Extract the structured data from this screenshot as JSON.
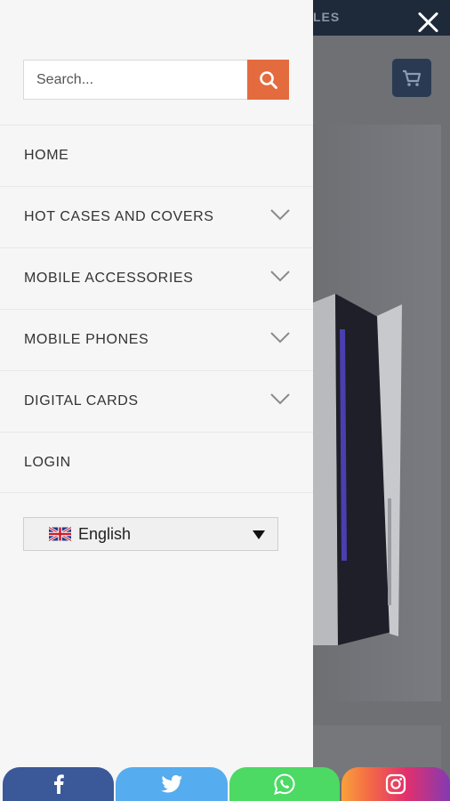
{
  "background": {
    "topbar_text": "LES",
    "accent": "#e46b3e",
    "topbar_color": "#1e2a3a"
  },
  "search": {
    "placeholder": "Search...",
    "button_icon": "search-icon"
  },
  "menu": {
    "items": [
      {
        "label": "HOME",
        "has_submenu": false
      },
      {
        "label": "HOT CASES AND COVERS",
        "has_submenu": true
      },
      {
        "label": "MOBILE ACCESSORIES",
        "has_submenu": true
      },
      {
        "label": "MOBILE PHONES",
        "has_submenu": true
      },
      {
        "label": "DIGITAL CARDS",
        "has_submenu": true
      },
      {
        "label": "LOGIN",
        "has_submenu": false
      }
    ]
  },
  "language": {
    "selected": "English",
    "flag_icon": "uk-flag-icon"
  },
  "share": {
    "buttons": [
      {
        "name": "facebook",
        "icon": "facebook-icon",
        "color": "#3b5998"
      },
      {
        "name": "twitter",
        "icon": "twitter-icon",
        "color": "#55acee"
      },
      {
        "name": "whatsapp",
        "icon": "whatsapp-icon",
        "color": "#4cd964"
      },
      {
        "name": "instagram",
        "icon": "instagram-icon",
        "color": "#e1306c"
      }
    ]
  }
}
